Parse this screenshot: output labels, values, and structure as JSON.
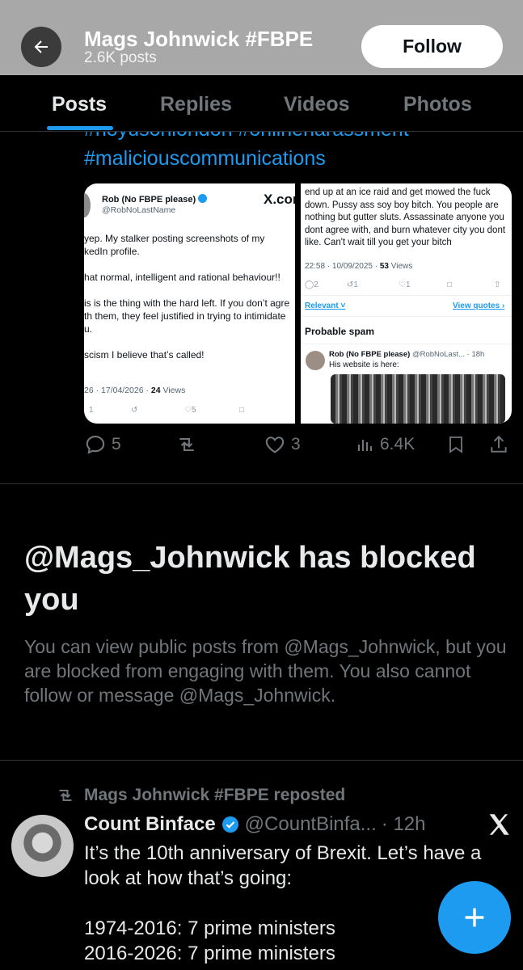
{
  "header": {
    "name": "Mags Johnwick #FBPE",
    "posts": "2.6K posts",
    "follow_label": "Follow"
  },
  "tabs": [
    "Posts",
    "Replies",
    "Videos",
    "Photos"
  ],
  "tweet1": {
    "hashtags_top": "#noyusonlondon #onlineharassment",
    "hashtags": "#maliciouscommunications",
    "screenshot_left": {
      "name": "Rob (No FBPE please)",
      "handle": "@RobNoLastName",
      "logo": "X.com",
      "lines": [
        "yep. My stalker posting screenshots of my",
        "kedIn profile.",
        "hat normal, intelligent and rational behaviour!!",
        "is is the thing with the hard left. If you don’t agre",
        "th them, they feel justified in trying to intimidate",
        "u.",
        "scism I believe that’s called!"
      ],
      "meta": "26 · 17/04/2026 ·",
      "views": "24",
      "views_label": "Views",
      "actions": [
        "1",
        "",
        "5",
        ""
      ]
    },
    "screenshot_right": {
      "text": "end up at an ice raid and get mowed the fuck down. Pussy ass soy boy bitch. You people are nothing but gutter sluts. Assassinate anyone you dont agree with, and burn whatever city you dont like. Can't wait till you get your bitch",
      "meta": "22:58 · 10/09/2025 ·",
      "views": "53",
      "views_label": "Views",
      "actions": [
        "2",
        "1",
        "1",
        "",
        ""
      ],
      "relevant": "Relevant",
      "view_quotes": "View quotes",
      "section": "Probable spam",
      "reply_name": "Rob (No FBPE please)",
      "reply_handle": "@RobNoLast... · 18h",
      "reply_text": "His website is here:"
    },
    "actions": {
      "replies": "5",
      "reposts": "",
      "likes": "3",
      "views": "6.4K"
    }
  },
  "blocked": {
    "title": "@Mags_Johnwick has blocked you",
    "description": "You can view public posts from @Mags_Johnwick, but you are blocked from engaging with them. You also cannot follow or message @Mags_Johnwick."
  },
  "tweet2": {
    "repost_label": "Mags Johnwick #FBPE reposted",
    "name": "Count Binface",
    "handle": "@CountBinfa...",
    "time": "· 12h",
    "lines": [
      "It’s the 10th anniversary of Brexit. Let’s have a",
      "look at how that’s going:",
      "",
      "1974-2016: 7 prime ministers",
      "2016-2026: 7 prime ministers"
    ]
  },
  "colors": {
    "accent": "#1d9bf0",
    "muted": "#71767b",
    "header_bg": "#a8a8a8"
  }
}
